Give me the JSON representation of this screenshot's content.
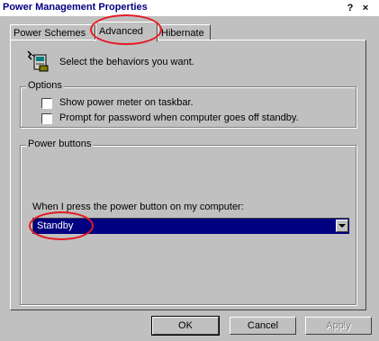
{
  "window": {
    "title": "Power Management Properties",
    "help_button": "?",
    "close_button": "×"
  },
  "tabs": [
    {
      "label": "Power Schemes",
      "active": false
    },
    {
      "label": "Advanced",
      "active": true
    },
    {
      "label": "Hibernate",
      "active": false
    }
  ],
  "advanced": {
    "description": "Select the behaviors you want.",
    "options": {
      "title": "Options",
      "show_meter_label": "Show power meter on taskbar.",
      "show_meter_checked": false,
      "prompt_password_label": "Prompt for password when computer goes off standby.",
      "prompt_password_checked": false
    },
    "power_buttons": {
      "title": "Power buttons",
      "button_action_label": "When I press the power button on my computer:",
      "button_action_value": "Standby"
    }
  },
  "buttons": {
    "ok": "OK",
    "cancel": "Cancel",
    "apply": "Apply"
  },
  "annotation_color": "#e31b23",
  "icon": "power-meter-icon"
}
